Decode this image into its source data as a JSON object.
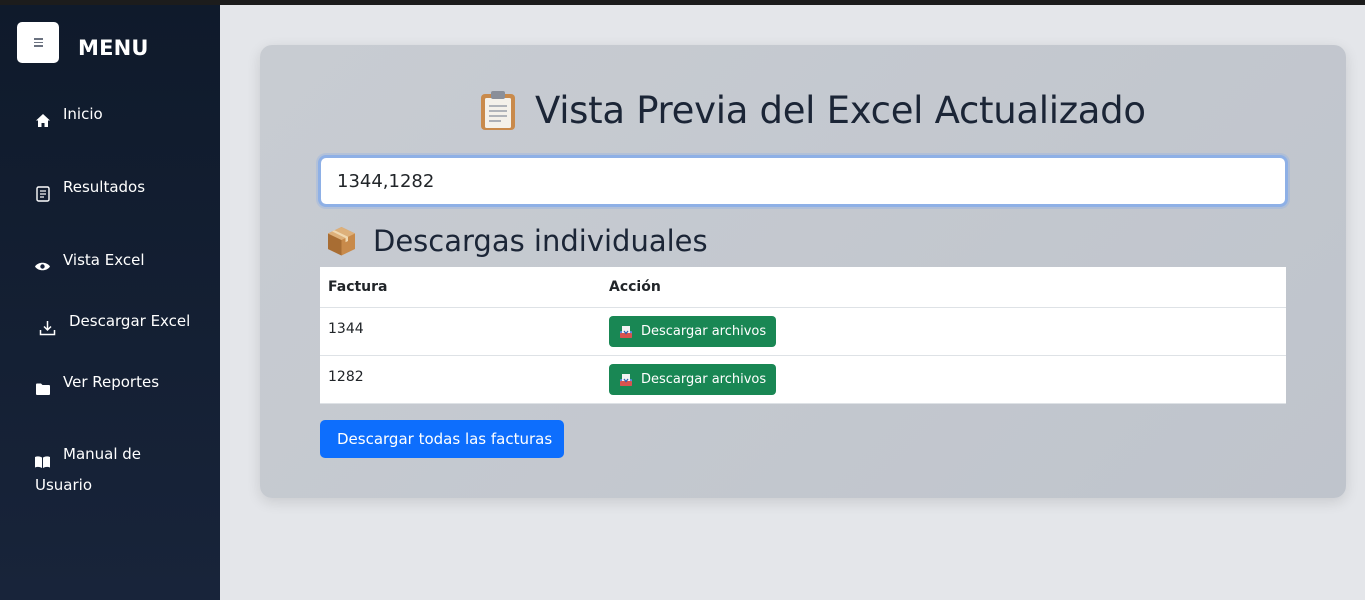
{
  "sidebar": {
    "menu_title": "MENU",
    "items": [
      {
        "label": "Inicio",
        "icon": "home-icon"
      },
      {
        "label": "Resultados",
        "icon": "receipt-icon"
      },
      {
        "label": "Vista Excel",
        "icon": "eye-icon"
      },
      {
        "label": "Descargar Excel",
        "icon": "download-icon"
      },
      {
        "label": "Ver Reportes",
        "icon": "folder-icon"
      },
      {
        "label": "Manual de Usuario",
        "icon": "book-icon"
      }
    ]
  },
  "main": {
    "title": "Vista Previa del Excel Actualizado",
    "title_icon": "clipboard-icon",
    "input_value": "1344,1282",
    "section_title": "Descargas individuales",
    "section_icon": "package-icon",
    "table": {
      "headers": [
        "Factura",
        "Acción"
      ],
      "rows": [
        {
          "factura": "1344",
          "action_label": "Descargar archivos"
        },
        {
          "factura": "1282",
          "action_label": "Descargar archivos"
        }
      ]
    },
    "download_all_label": "Descargar todas las facturas"
  },
  "colors": {
    "sidebar_bg": "#0f1a2b",
    "green_button": "#198754",
    "blue_button": "#0d6efd",
    "input_focus": "#8eb0e6"
  }
}
